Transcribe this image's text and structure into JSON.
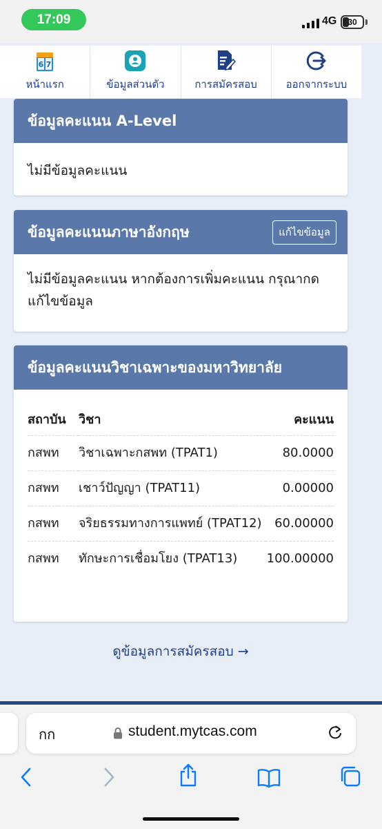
{
  "status_bar": {
    "time": "17:09",
    "network": "4G",
    "battery": "30"
  },
  "nav": {
    "items": [
      {
        "label": "หน้าแรก",
        "icon": "calendar-icon"
      },
      {
        "label": "ข้อมูลส่วนตัว",
        "icon": "profile-icon"
      },
      {
        "label": "การสมัครสอบ",
        "icon": "exam-form-icon"
      },
      {
        "label": "ออกจากระบบ",
        "icon": "logout-icon"
      }
    ],
    "calendar_numbers": [
      "6",
      "7"
    ]
  },
  "cards": {
    "alevel": {
      "title": "ข้อมูลคะแนน A-Level",
      "body": "ไม่มีข้อมูลคะแนน"
    },
    "english": {
      "title": "ข้อมูลคะแนนภาษาอังกฤษ",
      "edit_label": "แก้ไขข้อมูล",
      "body": "ไม่มีข้อมูลคะแนน หากต้องการเพิ่มคะแนน กรุณากด แก้ไขข้อมูล"
    },
    "university": {
      "title": "ข้อมูลคะแนนวิชาเฉพาะของมหาวิทยาลัย",
      "headers": {
        "institution": "สถาบัน",
        "subject": "วิชา",
        "score": "คะแนน"
      },
      "rows": [
        {
          "institution": "กสพท",
          "subject": "วิชาเฉพาะกสพท (TPAT1)",
          "score": "80.0000"
        },
        {
          "institution": "กสพท",
          "subject": "เชาว์ปัญญา (TPAT11)",
          "score": "0.00000"
        },
        {
          "institution": "กสพท",
          "subject": "จริยธรรมทางการแพทย์ (TPAT12)",
          "score": "60.00000"
        },
        {
          "institution": "กสพท",
          "subject": "ทักษะการเชื่อมโยง (TPAT13)",
          "score": "100.00000"
        }
      ]
    }
  },
  "view_link": "ดูข้อมูลการสมัครสอบ →",
  "browser": {
    "aa_label": "กก",
    "url": "student.mytcas.com"
  },
  "colors": {
    "header": "#5b78ab",
    "nav_text": "#1e3f8f",
    "accent_teal": "#1aa3b5",
    "ios_blue": "#0a7aff",
    "status_green": "#34c759"
  }
}
